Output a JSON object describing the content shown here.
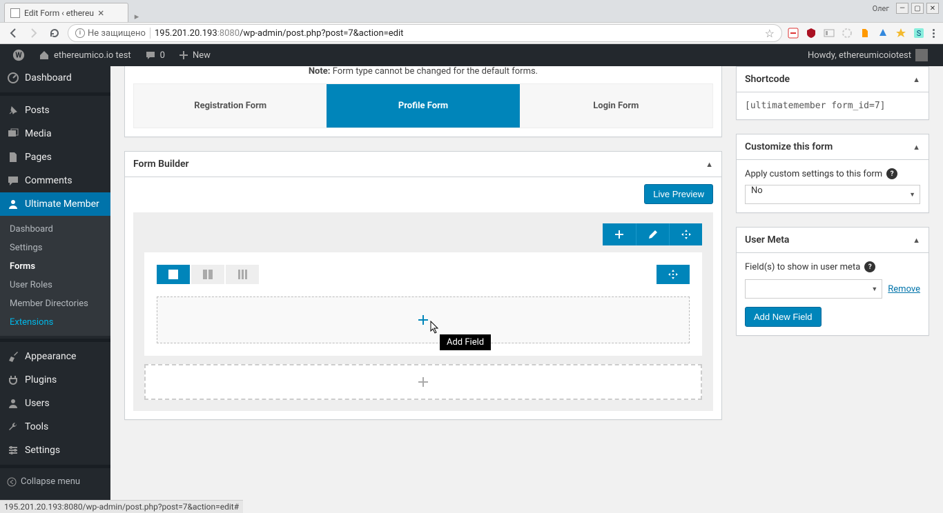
{
  "browser": {
    "tab_title": "Edit Form ‹ ethereu",
    "window_user": "Олег",
    "url_secure_label": "Не защищено",
    "url_host": "195.201.20.193",
    "url_port": ":8080",
    "url_path": "/wp-admin/post.php?post=7&action=edit",
    "status_bar": "195.201.20.193:8080/wp-admin/post.php?post=7&action=edit#"
  },
  "adminbar": {
    "site_name": "ethereumico.io test",
    "comments_count": "0",
    "new_label": "New",
    "howdy": "Howdy, ethereumicoiotest"
  },
  "menu": {
    "dashboard": "Dashboard",
    "posts": "Posts",
    "media": "Media",
    "pages": "Pages",
    "comments": "Comments",
    "ultimate_member": "Ultimate Member",
    "um_sub": {
      "dashboard": "Dashboard",
      "settings": "Settings",
      "forms": "Forms",
      "user_roles": "User Roles",
      "member_directories": "Member Directories",
      "extensions": "Extensions"
    },
    "appearance": "Appearance",
    "plugins": "Plugins",
    "users": "Users",
    "tools": "Tools",
    "settings": "Settings",
    "collapse": "Collapse menu"
  },
  "form_type": {
    "note_label": "Note:",
    "note_text": " Form type cannot be changed for the default forms.",
    "registration": "Registration Form",
    "profile": "Profile Form",
    "login": "Login Form"
  },
  "form_builder": {
    "title": "Form Builder",
    "live_preview": "Live Preview",
    "add_field_tooltip": "Add Field"
  },
  "sidebar": {
    "shortcode": {
      "title": "Shortcode",
      "value": "[ultimatemember form_id=7]"
    },
    "customize": {
      "title": "Customize this form",
      "label": "Apply custom settings to this form",
      "select_value": "No"
    },
    "user_meta": {
      "title": "User Meta",
      "label": "Field(s) to show in user meta",
      "remove": "Remove",
      "add_button": "Add New Field"
    }
  }
}
